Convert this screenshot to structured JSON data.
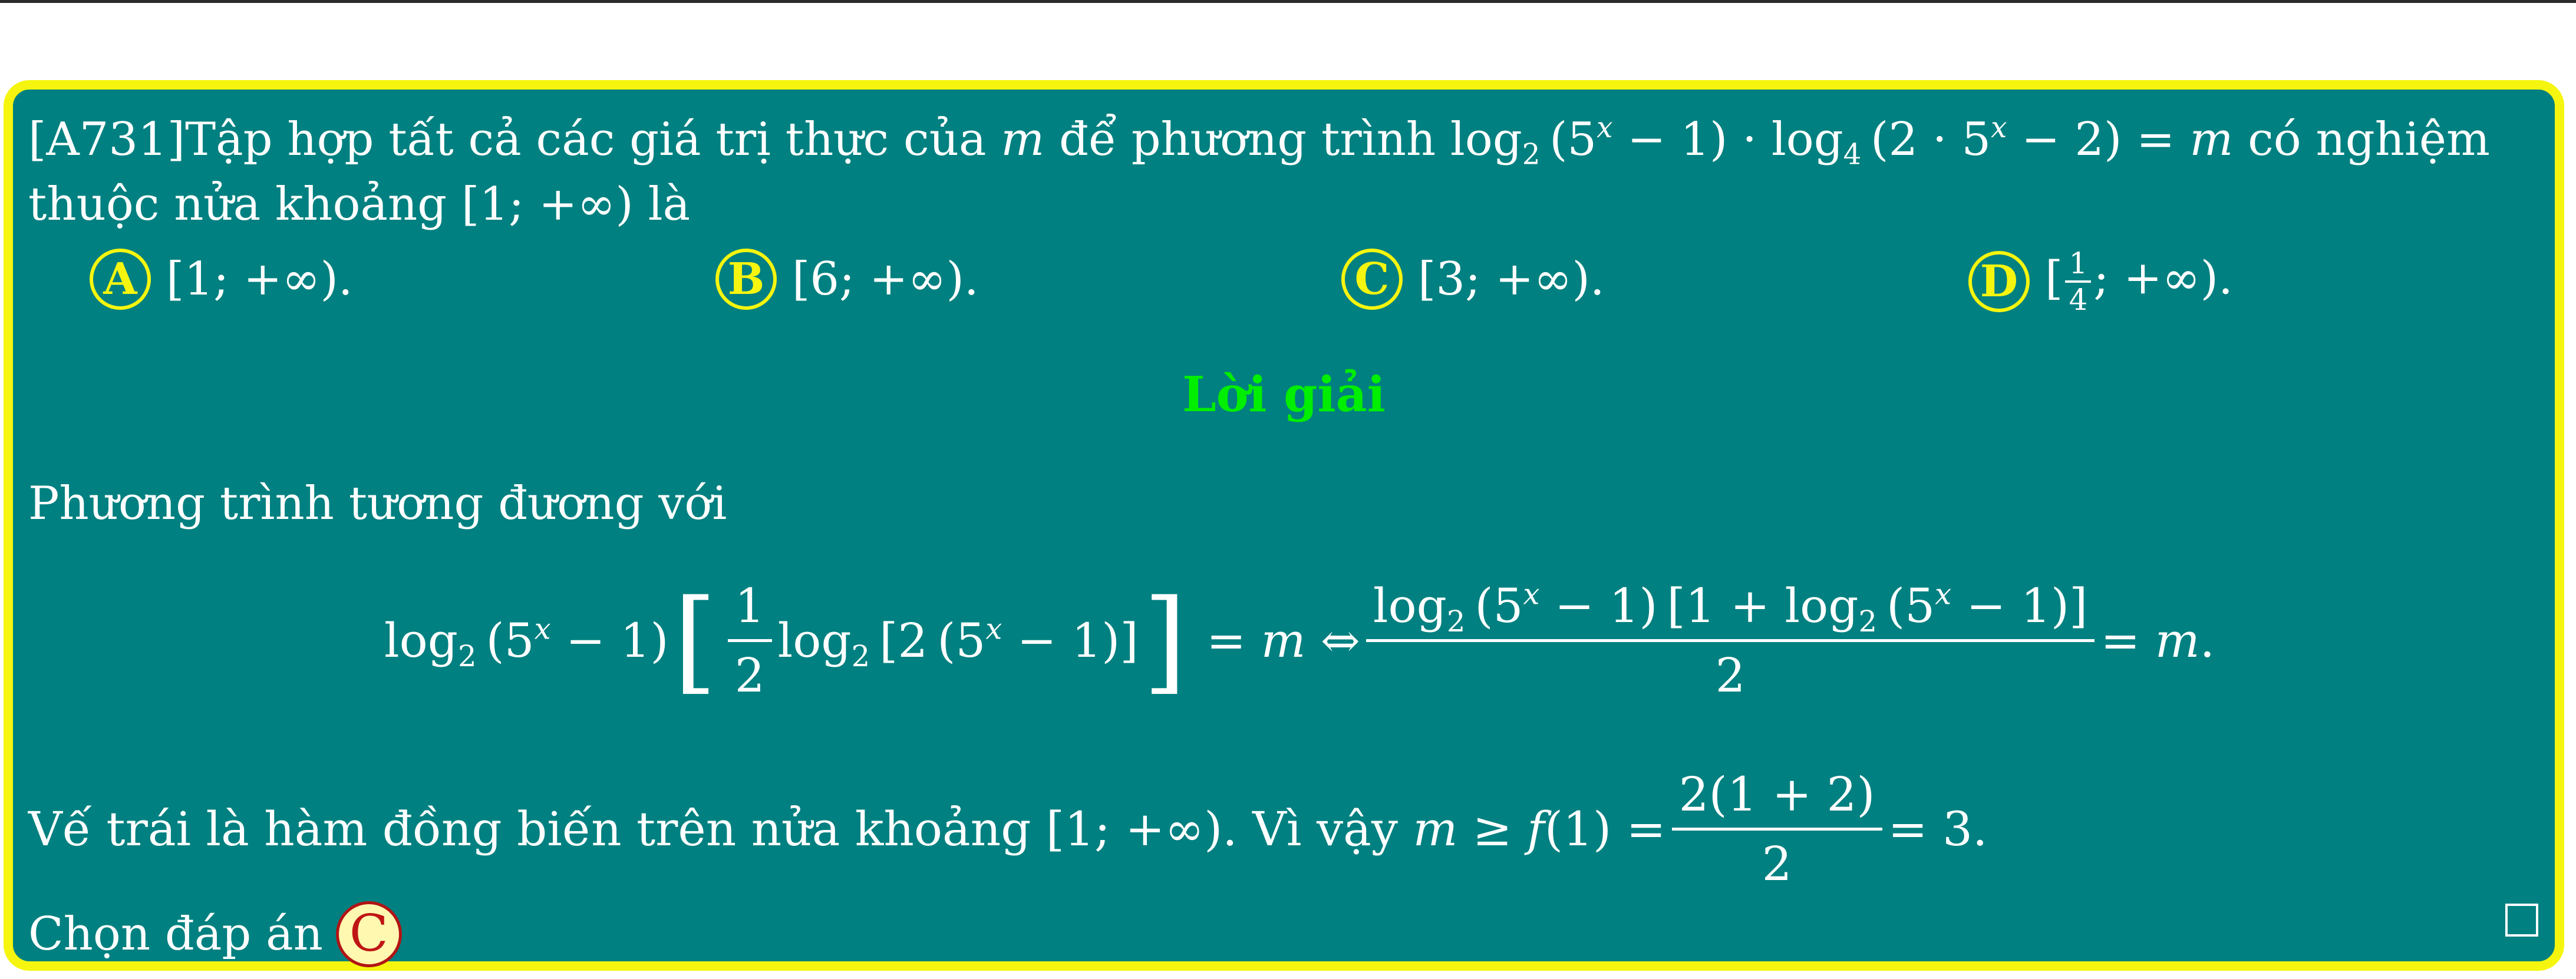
{
  "question": {
    "id": "[A731]",
    "stem_start": "Tập hợp tất cả các giá trị thực của",
    "var_m": "m",
    "stem_mid": "để phương trình",
    "equation": "log₂(5ˣ − 1) · log₄(2 · 5ˣ − 2) = m",
    "stem_end": "có nghiệm",
    "line2": "thuộc nửa khoảng [1; +∞) là"
  },
  "choices": [
    {
      "letter": "A",
      "text": "[1; +∞)."
    },
    {
      "letter": "B",
      "text": "[6; +∞)."
    },
    {
      "letter": "C",
      "text": "[3; +∞)."
    },
    {
      "letter": "D",
      "text": "[¼; +∞)."
    }
  ],
  "solution": {
    "heading": "Lời giải",
    "intro": "Phương trình tương đương với",
    "conclusion_text": "Vế trái là hàm đồng biến trên nửa khoảng [1; +∞). Vì vậy",
    "conclusion_math": "m ≥ f(1) = 2(1 + 2)/2 = 3.",
    "final_text": "Chọn đáp án",
    "final_answer": "C"
  },
  "colors": {
    "background": "#008080",
    "border": "#f5f50f",
    "heading": "#00ee00",
    "text": "#ffffff",
    "answer_badge_fill": "#fff8b0",
    "answer_badge_text": "#c01515"
  }
}
